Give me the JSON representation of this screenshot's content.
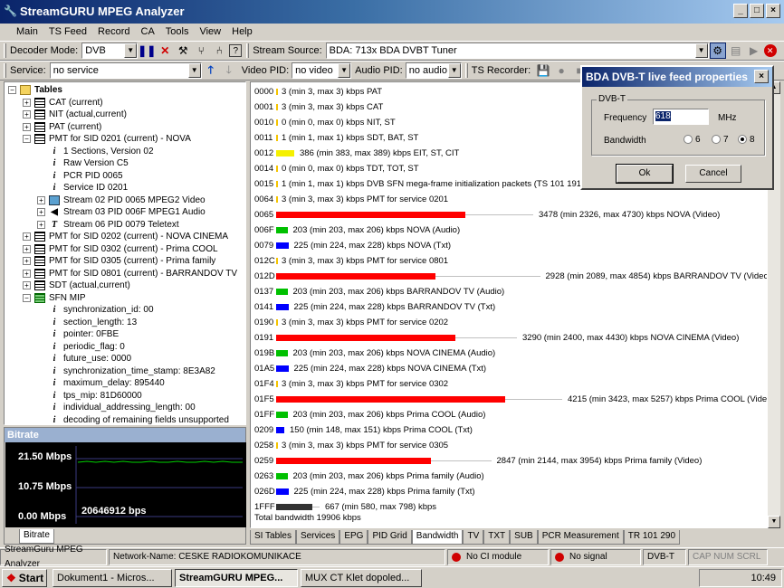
{
  "window": {
    "title": "StreamGURU MPEG Analyzer",
    "minimize": "_",
    "maximize": "□",
    "close": "×"
  },
  "menu": [
    "Main",
    "TS Feed",
    "Record",
    "CA",
    "Tools",
    "View",
    "Help"
  ],
  "toolbar1": {
    "decoder_label": "Decoder Mode:",
    "decoder_value": "DVB",
    "source_label": "Stream Source:",
    "source_value": "BDA: 713x BDA DVBT Tuner"
  },
  "toolbar2": {
    "service_label": "Service:",
    "service_value": "no service",
    "video_label": "Video PID:",
    "video_value": "no video",
    "audio_label": "Audio PID:",
    "audio_value": "no audio",
    "recorder_label": "TS Recorder:"
  },
  "tree": {
    "items": [
      {
        "label": "Tables",
        "icon": "folder",
        "exp": "−"
      },
      {
        "label": "CAT (current)",
        "icon": "table",
        "exp": "+"
      },
      {
        "label": "NIT (actual,current)",
        "icon": "table",
        "exp": "+"
      },
      {
        "label": "PAT (current)",
        "icon": "table",
        "exp": "+"
      },
      {
        "label": "PMT for SID 0201 (current) - NOVA",
        "icon": "table",
        "exp": "−"
      },
      {
        "label": "1 Sections, Version 02",
        "icon": "info",
        "exp": ""
      },
      {
        "label": "Raw Version C5",
        "icon": "info",
        "exp": ""
      },
      {
        "label": "PCR PID 0065",
        "icon": "info",
        "exp": ""
      },
      {
        "label": "Service ID 0201",
        "icon": "info",
        "exp": ""
      },
      {
        "label": "Stream 02 PID 0065 MPEG2 Video",
        "icon": "video",
        "exp": "+"
      },
      {
        "label": "Stream 03 PID 006F MPEG1 Audio",
        "icon": "audio",
        "exp": "+"
      },
      {
        "label": "Stream 06 PID 0079 Teletext",
        "icon": "text",
        "exp": "+"
      },
      {
        "label": "PMT for SID 0202 (current) - NOVA CINEMA",
        "icon": "table",
        "exp": "+"
      },
      {
        "label": "PMT for SID 0302 (current) - Prima COOL",
        "icon": "table",
        "exp": "+"
      },
      {
        "label": "PMT for SID 0305 (current) - Prima family",
        "icon": "table",
        "exp": "+"
      },
      {
        "label": "PMT for SID 0801 (current) - BARRANDOV TV",
        "icon": "table",
        "exp": "+"
      },
      {
        "label": "SDT (actual,current)",
        "icon": "table",
        "exp": "+"
      },
      {
        "label": "SFN MIP",
        "icon": "tablegreen",
        "exp": "−"
      },
      {
        "label": "synchronization_id: 00",
        "icon": "info",
        "exp": ""
      },
      {
        "label": "section_length: 13",
        "icon": "info",
        "exp": ""
      },
      {
        "label": "pointer: 0FBE",
        "icon": "info",
        "exp": ""
      },
      {
        "label": "periodic_flag: 0",
        "icon": "info",
        "exp": ""
      },
      {
        "label": "future_use: 0000",
        "icon": "info",
        "exp": ""
      },
      {
        "label": "synchronization_time_stamp: 8E3A82",
        "icon": "info",
        "exp": ""
      },
      {
        "label": "maximum_delay: 895440",
        "icon": "info",
        "exp": ""
      },
      {
        "label": "tps_mip: 81D60000",
        "icon": "info",
        "exp": ""
      },
      {
        "label": "individual_addressing_length: 00",
        "icon": "info",
        "exp": ""
      },
      {
        "label": "decoding of remaining fields unsupported",
        "icon": "info",
        "exp": ""
      }
    ]
  },
  "bitrate": {
    "caption": "Bitrate",
    "max": "21.50 Mbps",
    "mid": "10.75 Mbps",
    "min": "0.00 Mbps",
    "current": "20646912 bps",
    "tab": "Bitrate"
  },
  "rows": [
    {
      "pid": "0000",
      "color": "#f5c400",
      "value": 0,
      "text": "3 (min 3, max 3) kbps  PAT"
    },
    {
      "pid": "0001",
      "color": "#f5c400",
      "value": 0,
      "text": "3 (min 3, max 3) kbps  CAT"
    },
    {
      "pid": "0010",
      "color": "#f5c400",
      "value": 0,
      "text": "0 (min 0, max 0) kbps  NIT, ST"
    },
    {
      "pid": "0011",
      "color": "#f5c400",
      "value": 0,
      "text": "1 (min 1, max 1) kbps  SDT, BAT, ST"
    },
    {
      "pid": "0012",
      "color": "#f5f000",
      "value": 0.04,
      "text": "386 (min 383, max 389) kbps  EIT, ST, CIT"
    },
    {
      "pid": "0014",
      "color": "#f5c400",
      "value": 0,
      "text": "0 (min 0, max 0) kbps  TDT, TOT, ST"
    },
    {
      "pid": "0015",
      "color": "#f5c400",
      "value": 0,
      "text": "1 (min 1, max 1) kbps  DVB SFN mega-frame initialization packets (TS 101 191)"
    },
    {
      "pid": "0064",
      "color": "#f5c400",
      "value": 0,
      "text": "3 (min 3, max 3) kbps  PMT for service 0201"
    },
    {
      "pid": "0065",
      "color": "#ff0000",
      "value": 0.418,
      "max": 0.568,
      "cur": 0.418,
      "text": "3478 (min 2326, max 4730) kbps  NOVA (Video)"
    },
    {
      "pid": "006F",
      "color": "#00c000",
      "value": 0.025,
      "text": "203 (min 203, max 206) kbps  NOVA (Audio)"
    },
    {
      "pid": "0079",
      "color": "#0000ff",
      "value": 0.027,
      "text": "225 (min 224, max 228) kbps  NOVA (Txt)"
    },
    {
      "pid": "012C",
      "color": "#f5c400",
      "value": 0,
      "text": "3 (min 3, max 3) kbps  PMT for service 0801"
    },
    {
      "pid": "012D",
      "color": "#ff0000",
      "value": 0.352,
      "max": 0.583,
      "cur": 0.352,
      "text": "2928 (min 2089, max 4854) kbps  BARRANDOV TV (Video)"
    },
    {
      "pid": "0137",
      "color": "#00c000",
      "value": 0.025,
      "text": "203 (min 203, max 206) kbps  BARRANDOV TV (Audio)"
    },
    {
      "pid": "0141",
      "color": "#0000ff",
      "value": 0.027,
      "text": "225 (min 224, max 228) kbps  BARRANDOV TV (Txt)"
    },
    {
      "pid": "0190",
      "color": "#f5c400",
      "value": 0,
      "text": "3 (min 3, max 3) kbps  PMT for service 0202"
    },
    {
      "pid": "0191",
      "color": "#ff0000",
      "value": 0.395,
      "max": 0.532,
      "cur": 0.395,
      "text": "3290 (min 2400, max 4430) kbps  NOVA CINEMA (Video)"
    },
    {
      "pid": "019B",
      "color": "#00c000",
      "value": 0.025,
      "text": "203 (min 203, max 206) kbps  NOVA CINEMA (Audio)"
    },
    {
      "pid": "01A5",
      "color": "#0000ff",
      "value": 0.027,
      "text": "225 (min 224, max 228) kbps  NOVA CINEMA (Txt)"
    },
    {
      "pid": "01F4",
      "color": "#f5c400",
      "value": 0,
      "text": "3 (min 3, max 3) kbps  PMT for service 0302"
    },
    {
      "pid": "01F5",
      "color": "#ff0000",
      "value": 0.506,
      "max": 0.632,
      "cur": 0.506,
      "text": "4215 (min 3423, max 5257) kbps  Prima COOL (Video)"
    },
    {
      "pid": "01FF",
      "color": "#00c000",
      "value": 0.025,
      "text": "203 (min 203, max 206) kbps  Prima COOL (Audio)"
    },
    {
      "pid": "0209",
      "color": "#0000ff",
      "value": 0.018,
      "text": "150 (min 148, max 151) kbps  Prima COOL (Txt)"
    },
    {
      "pid": "0258",
      "color": "#f5c400",
      "value": 0,
      "text": "3 (min 3, max 3) kbps  PMT for service 0305"
    },
    {
      "pid": "0259",
      "color": "#ff0000",
      "value": 0.342,
      "max": 0.475,
      "cur": 0.342,
      "text": "2847 (min 2144, max 3954) kbps  Prima family (Video)"
    },
    {
      "pid": "0263",
      "color": "#00c000",
      "value": 0.025,
      "text": "203 (min 203, max 206) kbps  Prima family (Audio)"
    },
    {
      "pid": "026D",
      "color": "#0000ff",
      "value": 0.027,
      "text": "225 (min 224, max 228) kbps  Prima family (Txt)"
    },
    {
      "pid": "1FFF",
      "color": "#333333",
      "value": 0.08,
      "max": 0.096,
      "cur": 0.08,
      "text": "667 (min 580, max 798) kbps"
    }
  ],
  "total": "Total bandwidth  19906 kbps",
  "tabs": [
    "SI Tables",
    "Services",
    "EPG",
    "PID Grid",
    "Bandwidth",
    "TV",
    "TXT",
    "SUB",
    "PCR Measurement",
    "TR 101 290"
  ],
  "active_tab": "Bandwidth",
  "status": {
    "app": "StreamGuru MPEG Analyzer",
    "network": "Network-Name: CESKE RADIOKOMUNIKACE",
    "ci": "No CI module",
    "signal": "No signal",
    "mode": "DVB-T",
    "keys": "CAP  NUM  SCRL"
  },
  "taskbar": {
    "start": "Start",
    "items": [
      "Dokument1 - Micros...",
      "StreamGURU MPEG...",
      "MUX CT Klet dopoled..."
    ],
    "time": "10:49"
  },
  "dialog": {
    "title": "BDA DVB-T live feed properties",
    "group": "DVB-T",
    "freq_label": "Frequency",
    "freq_value": "618",
    "freq_unit": "MHz",
    "bw_label": "Bandwidth",
    "bw6": "6",
    "bw7": "7",
    "bw8": "8",
    "ok": "Ok",
    "cancel": "Cancel"
  }
}
